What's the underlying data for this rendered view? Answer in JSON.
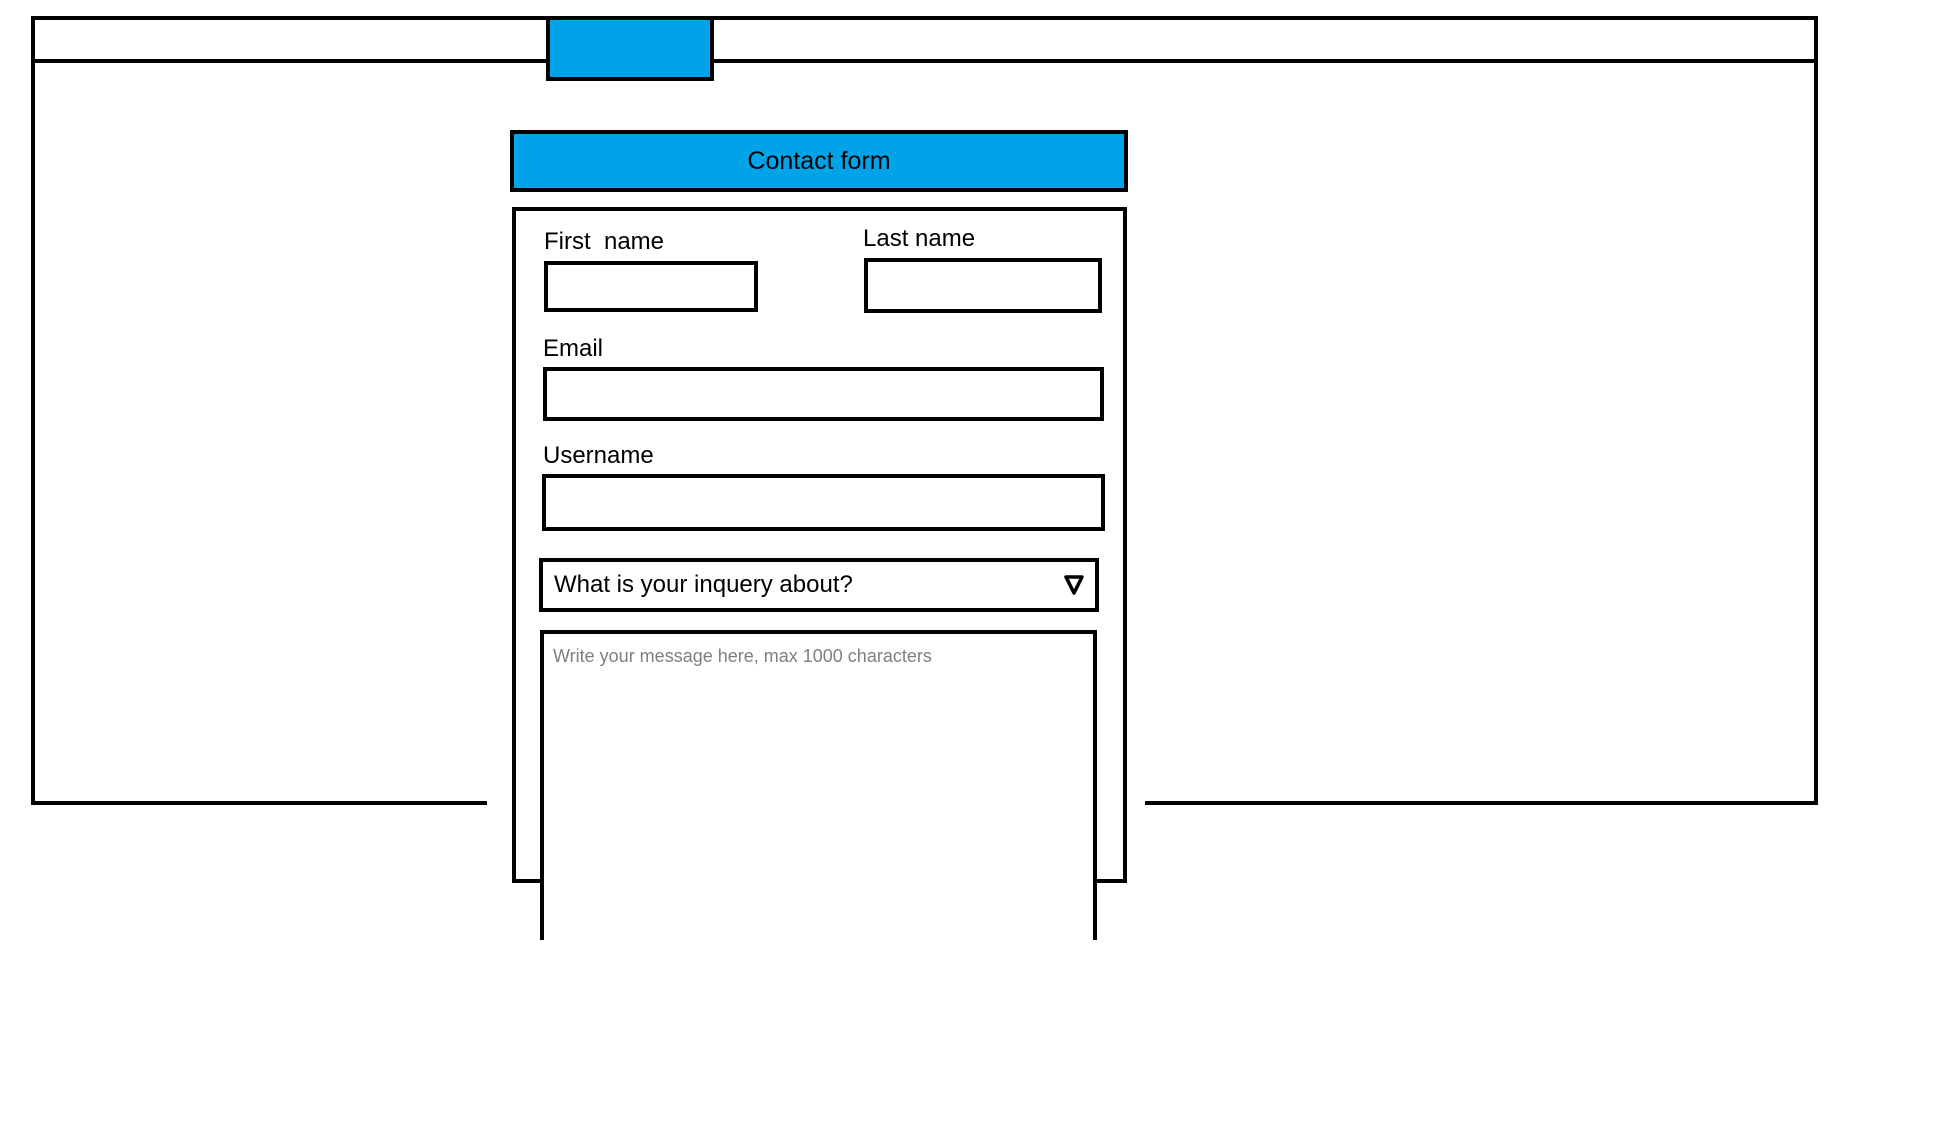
{
  "colors": {
    "accent": "#00a2e8",
    "border": "#000000",
    "placeholder": "#7f7f7f"
  },
  "form": {
    "title": "Contact form",
    "first_name_label": "First  name",
    "last_name_label": "Last name",
    "email_label": "Email",
    "username_label": "Username",
    "inquiry_select": {
      "value": "What is your inquery about?",
      "icon": "triangle-down-icon"
    },
    "message_placeholder": "Write your message here, max 1000 characters"
  }
}
